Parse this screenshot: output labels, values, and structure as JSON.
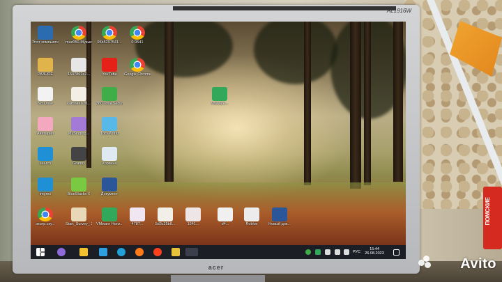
{
  "monitor": {
    "model": "AL1916W",
    "brand": "acer"
  },
  "watermark": "Avito",
  "marker_label": "ПОМСКИЕ",
  "desktop": {
    "icons": [
      {
        "label": "Этот компьютер",
        "icon": "computer-icon",
        "color": "#2b6cb0"
      },
      {
        "label": "muz050-Музыка_3к...",
        "icon": "chrome-icon",
        "color": "chrome"
      },
      {
        "label": "05b5297541...",
        "icon": "chrome-icon",
        "color": "chrome"
      },
      {
        "label": "0-9541",
        "icon": "chrome-icon",
        "color": "chrome"
      },
      {
        "label": "РАЗНОЕ",
        "icon": "folder-icon",
        "color": "#e0b44a"
      },
      {
        "label": "1647861e2...",
        "icon": "document-icon",
        "color": "#e6e6e6"
      },
      {
        "label": "YouTube",
        "icon": "youtube-icon",
        "color": "#e62117"
      },
      {
        "label": "Google Chrome",
        "icon": "chrome-icon",
        "color": "chrome"
      },
      {
        "label": "No.Draw",
        "icon": "heart-icon",
        "color": "#f2f2f2"
      },
      {
        "label": "kartinkar-20...",
        "icon": "image-icon",
        "color": "#f3efe6"
      },
      {
        "label": "360 Total Security",
        "icon": "shield-plus-icon",
        "color": "#3fae49"
      },
      {
        "label": "VMware...",
        "icon": "cloud-icon",
        "color": "#31a85a"
      },
      {
        "label": "Аватария",
        "icon": "game-icon",
        "color": "#f4a8c0"
      },
      {
        "label": "MySinging...",
        "icon": "game-icon",
        "color": "#a37ad6"
      },
      {
        "label": "TocaWorld",
        "icon": "game-icon",
        "color": "#58b9e8"
      },
      {
        "label": "search",
        "icon": "edge-icon",
        "color": "#1f8fd6"
      },
      {
        "label": "Granny",
        "icon": "game-icon",
        "color": "#444444"
      },
      {
        "label": "Корзина",
        "icon": "recycle-bin-icon",
        "color": "#dfe9f2"
      },
      {
        "label": "imgres",
        "icon": "edge-icon",
        "color": "#1f8fd6"
      },
      {
        "label": "BlueStacks X",
        "icon": "bluestacks-icon",
        "color": "#7ac943"
      },
      {
        "label": "Документ",
        "icon": "word-icon",
        "color": "#2b579a"
      },
      {
        "label": "экспр.ску...",
        "icon": "chrome-icon",
        "color": "chrome"
      },
      {
        "label": "Start_Survey_ 20...",
        "icon": "document-icon",
        "color": "#e8d8b8"
      },
      {
        "label": "VMware Horiz...",
        "icon": "cloud-icon",
        "color": "#31a85a"
      },
      {
        "label": "4787...",
        "icon": "image-icon",
        "color": "#f0e6f2"
      },
      {
        "label": "5d3c35b8...",
        "icon": "image-icon",
        "color": "#f2efe8"
      },
      {
        "label": "1641...",
        "icon": "image-icon",
        "color": "#eee6e6"
      },
      {
        "label": "d4...",
        "icon": "image-icon",
        "color": "#f0f0f0"
      },
      {
        "label": "Roblox",
        "icon": "roblox-icon",
        "color": "#ececec"
      },
      {
        "label": "Новый док...",
        "icon": "word-icon",
        "color": "#2b579a"
      }
    ]
  },
  "taskbar": {
    "lang": "РУС",
    "time": "15:44",
    "date": "26.08.2023"
  }
}
